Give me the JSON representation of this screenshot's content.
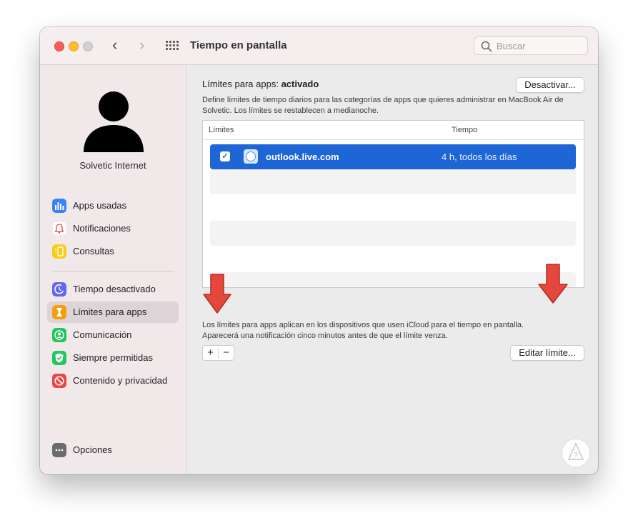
{
  "window": {
    "title": "Tiempo en pantalla",
    "search_placeholder": "Buscar"
  },
  "sidebar": {
    "username": "Solvetic Internet",
    "items": [
      {
        "label": "Apps usadas",
        "icon": "bar-chart-icon",
        "color": "#3b82f6"
      },
      {
        "label": "Notificaciones",
        "icon": "bell-icon",
        "color": "#ef4444"
      },
      {
        "label": "Consultas",
        "icon": "phone-pickup-icon",
        "color": "#facc15"
      },
      {
        "label": "Tiempo desactivado",
        "icon": "downtime-icon",
        "color": "#6366f1"
      },
      {
        "label": "Límites para apps",
        "icon": "hourglass-icon",
        "color": "#f59e0b",
        "selected": true
      },
      {
        "label": "Comunicación",
        "icon": "person-icon",
        "color": "#22c55e"
      },
      {
        "label": "Siempre permitidas",
        "icon": "checkmark-shield-icon",
        "color": "#22c55e"
      },
      {
        "label": "Contenido y privacidad",
        "icon": "no-entry-icon",
        "color": "#ef4444"
      }
    ],
    "options_label": "Opciones"
  },
  "main": {
    "status_prefix": "Límites para apps: ",
    "status_value": "activado",
    "deactivate_button": "Desactivar...",
    "description": "Define límites de tiempo diarios para las categorías de apps que quieres administrar en MacBook Air de Solvetic. Los límites se restablecen a medianoche.",
    "table": {
      "col_limits": "Límites",
      "col_time": "Tiempo",
      "rows": [
        {
          "name": "outlook.live.com",
          "time": "4 h, todos los días",
          "checked": true
        }
      ]
    },
    "note_line1": "Los límites para apps aplican en los dispositivos que usen iCloud para el tiempo en pantalla.",
    "note_line2": "Aparecerá una notificación cinco minutos antes de que el límite venza.",
    "add_label": "+",
    "remove_label": "−",
    "edit_button": "Editar límite..."
  },
  "colors": {
    "selection_blue": "#1e66d6",
    "arrow_red": "#e5473c"
  }
}
